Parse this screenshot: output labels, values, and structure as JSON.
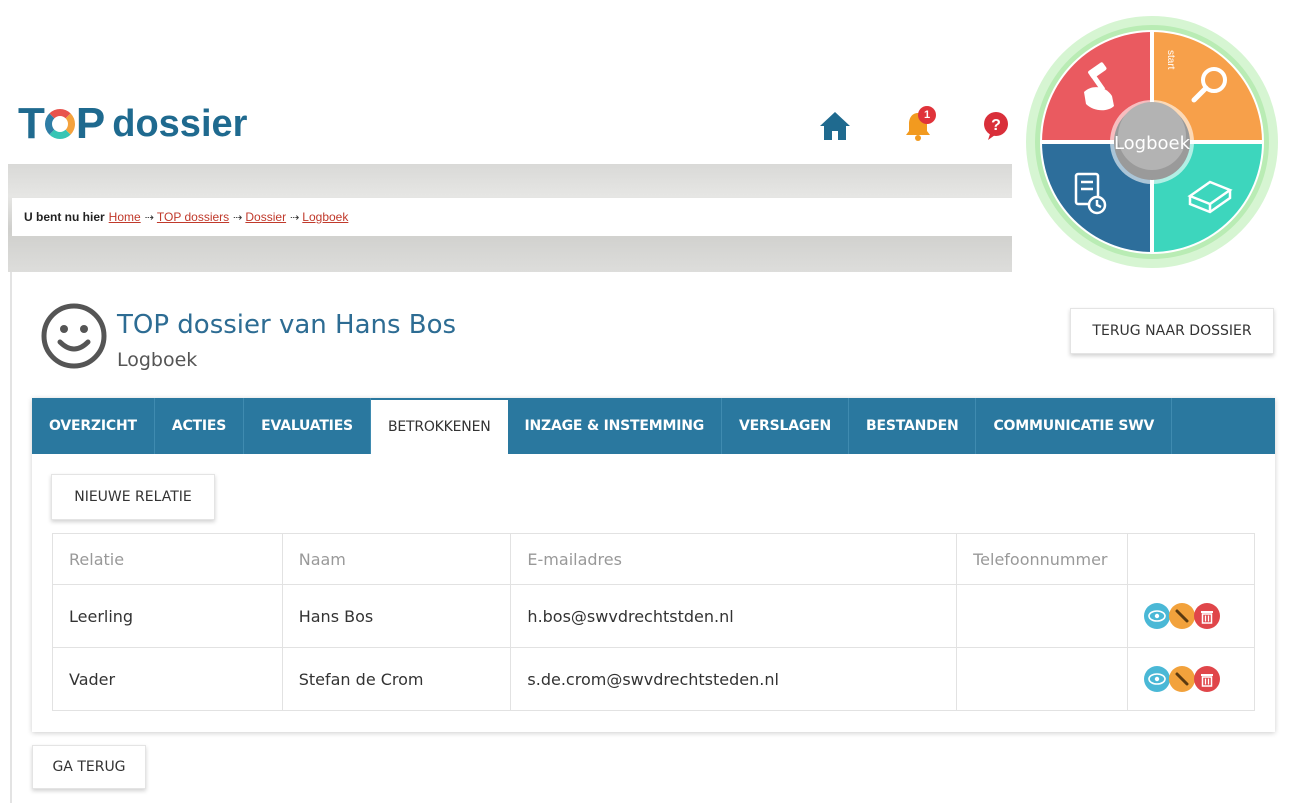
{
  "header": {
    "logo_mark": "TOP",
    "logo_word": "dossier",
    "notification_count": "1",
    "icons": [
      "home-icon",
      "bell-icon",
      "help-icon"
    ]
  },
  "breadcrumb": {
    "lead": "U bent nu hier",
    "items": [
      "Home",
      "TOP dossiers",
      "Dossier",
      "Logboek"
    ]
  },
  "wheel": {
    "center_label": "Logboek",
    "start_label": "start",
    "segments": [
      "hammer-hand-icon",
      "search-icon",
      "document-clock-icon",
      "book-icon"
    ],
    "colors": {
      "red": "#ea5a60",
      "orange": "#f7a04a",
      "blue": "#2d6e9b",
      "teal": "#3dd6bd",
      "ring": "#b9ecb4"
    }
  },
  "page": {
    "title": "TOP dossier van Hans Bos",
    "subtitle": "Logboek",
    "back_to_dossier": "TERUG NAAR DOSSIER",
    "go_back": "GA TERUG"
  },
  "tabs": [
    {
      "label": "OVERZICHT",
      "active": false
    },
    {
      "label": "ACTIES",
      "active": false
    },
    {
      "label": "EVALUATIES",
      "active": false
    },
    {
      "label": "BETROKKENEN",
      "active": true
    },
    {
      "label": "INZAGE & INSTEMMING",
      "active": false
    },
    {
      "label": "VERSLAGEN",
      "active": false
    },
    {
      "label": "BESTANDEN",
      "active": false
    },
    {
      "label": "COMMUNICATIE SWV",
      "active": false
    }
  ],
  "panel": {
    "new_relation": "NIEUWE RELATIE",
    "columns": [
      "Relatie",
      "Naam",
      "E-mailadres",
      "Telefoonnummer",
      ""
    ],
    "rows": [
      {
        "relatie": "Leerling",
        "naam": "Hans Bos",
        "email": "h.bos@swvdrechtstden.nl",
        "telefoon": ""
      },
      {
        "relatie": "Vader",
        "naam": "Stefan de Crom",
        "email": "s.de.crom@swvdrechtsteden.nl",
        "telefoon": ""
      }
    ],
    "row_actions": [
      "eye-icon",
      "pencil-icon",
      "trash-icon"
    ]
  },
  "colors": {
    "brand_blue": "#2a789f",
    "title_blue": "#2d6c93",
    "link_red": "#c0392b"
  }
}
